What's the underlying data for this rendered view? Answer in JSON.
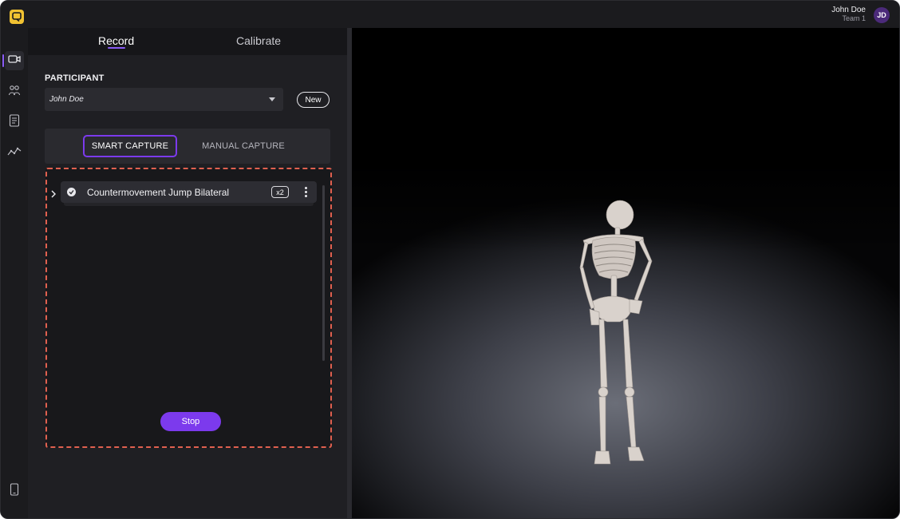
{
  "user": {
    "name": "John Doe",
    "team": "Team 1",
    "initials": "JD"
  },
  "tabs": {
    "record": "Record",
    "calibrate": "Calibrate"
  },
  "participant": {
    "label": "PARTICIPANT",
    "selected": "John Doe",
    "new_button": "New"
  },
  "capture_mode": {
    "smart": "SMART CAPTURE",
    "manual": "MANUAL CAPTURE"
  },
  "capture_list": [
    {
      "label": "Countermovement Jump Bilateral",
      "count": "x2"
    }
  ],
  "stop_button": "Stop",
  "colors": {
    "accent": "#7c3aed",
    "logo": "#f1c232",
    "dashed_border": "#e0604f"
  },
  "icons": {
    "rail": [
      "record-camera-icon",
      "participants-icon",
      "reports-icon",
      "analytics-icon",
      "device-icon"
    ]
  }
}
